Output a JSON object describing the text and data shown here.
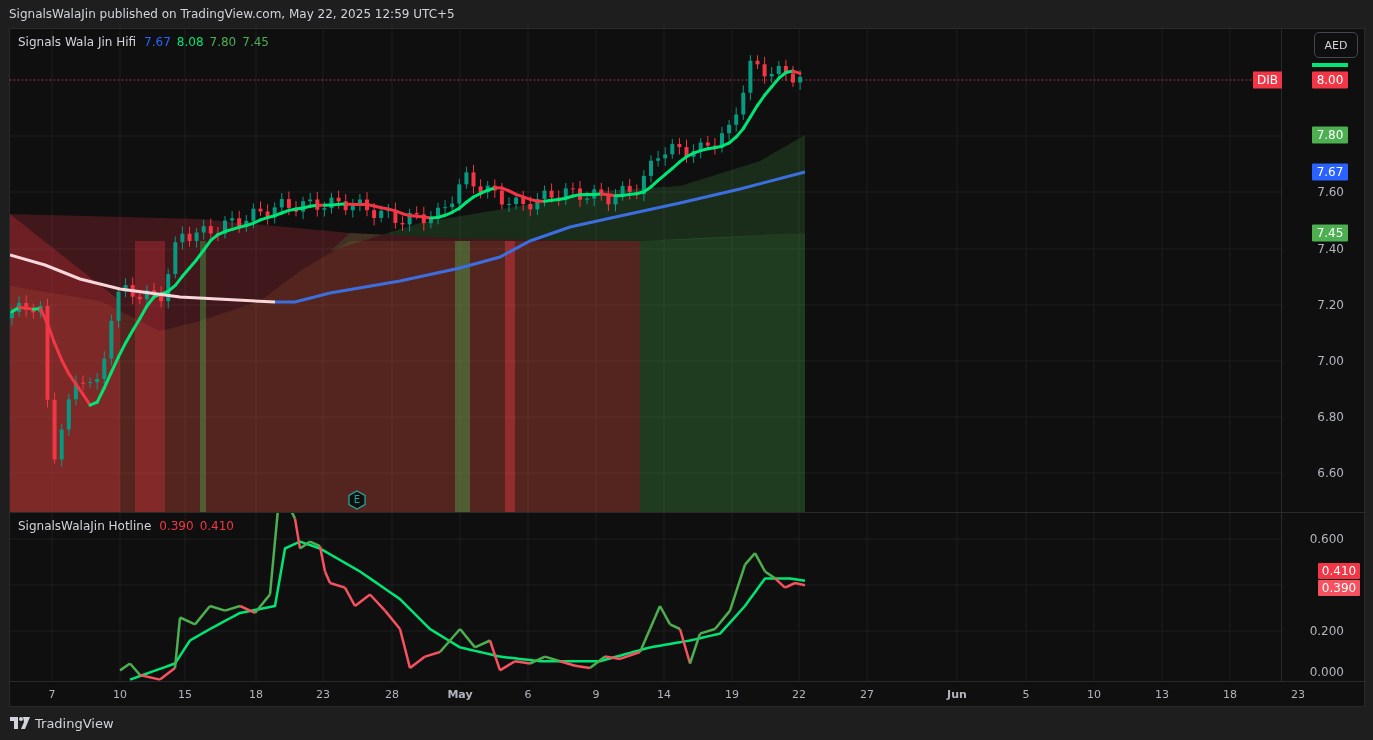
{
  "header": {
    "publish_line": "SignalsWalaJin published on TradingView.com, May 22, 2025 12:59 UTC+5"
  },
  "main_pane": {
    "legend": {
      "title": "Signals Wala Jin Hifi",
      "values": [
        {
          "text": "7.67",
          "color": "#2962ff"
        },
        {
          "text": "8.08",
          "color": "#00e676"
        },
        {
          "text": "7.80",
          "color": "#4caf50"
        },
        {
          "text": "7.45",
          "color": "#4caf50"
        }
      ]
    },
    "currency_button": "AED",
    "price_ticks": [
      "7.60",
      "7.40",
      "7.20",
      "7.00",
      "6.80",
      "6.60"
    ],
    "badges": [
      {
        "symbol": "DIB",
        "text": "8.00",
        "color": "#f23645"
      },
      {
        "text": "7.80",
        "color": "#4caf50"
      },
      {
        "text": "7.67",
        "color": "#2962ff"
      },
      {
        "text": "7.45",
        "color": "#4caf50"
      }
    ],
    "earnings_marker": "E"
  },
  "oscillator_pane": {
    "legend": {
      "title": "SignalsWalaJin Hotline",
      "values": [
        {
          "text": "0.390",
          "color": "#f23645"
        },
        {
          "text": "0.410",
          "color": "#f23645"
        }
      ]
    },
    "ticks": [
      "0.600",
      "0.200",
      "0.000"
    ],
    "badges": [
      {
        "text": "0.410",
        "color": "#f23645"
      },
      {
        "text": "0.390",
        "color": "#f7525f"
      }
    ]
  },
  "time_axis": {
    "labels": [
      "7",
      "10",
      "15",
      "18",
      "23",
      "28",
      "May",
      "6",
      "9",
      "14",
      "19",
      "22",
      "27",
      "Jun",
      "5",
      "10",
      "13",
      "18",
      "23"
    ]
  },
  "footer": {
    "brand": "TradingView"
  }
}
